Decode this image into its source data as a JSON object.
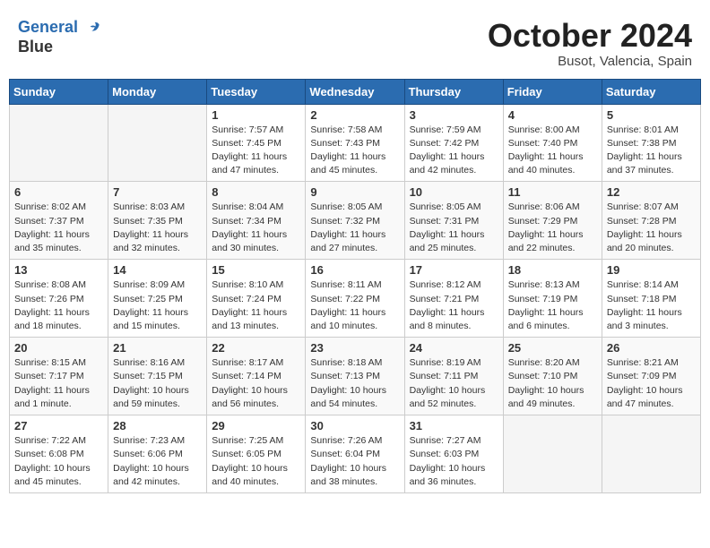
{
  "header": {
    "logo_line1": "General",
    "logo_line2": "Blue",
    "month_title": "October 2024",
    "location": "Busot, Valencia, Spain"
  },
  "weekdays": [
    "Sunday",
    "Monday",
    "Tuesday",
    "Wednesday",
    "Thursday",
    "Friday",
    "Saturday"
  ],
  "weeks": [
    [
      {
        "day": "",
        "sunrise": "",
        "sunset": "",
        "daylight": ""
      },
      {
        "day": "",
        "sunrise": "",
        "sunset": "",
        "daylight": ""
      },
      {
        "day": "1",
        "sunrise": "Sunrise: 7:57 AM",
        "sunset": "Sunset: 7:45 PM",
        "daylight": "Daylight: 11 hours and 47 minutes."
      },
      {
        "day": "2",
        "sunrise": "Sunrise: 7:58 AM",
        "sunset": "Sunset: 7:43 PM",
        "daylight": "Daylight: 11 hours and 45 minutes."
      },
      {
        "day": "3",
        "sunrise": "Sunrise: 7:59 AM",
        "sunset": "Sunset: 7:42 PM",
        "daylight": "Daylight: 11 hours and 42 minutes."
      },
      {
        "day": "4",
        "sunrise": "Sunrise: 8:00 AM",
        "sunset": "Sunset: 7:40 PM",
        "daylight": "Daylight: 11 hours and 40 minutes."
      },
      {
        "day": "5",
        "sunrise": "Sunrise: 8:01 AM",
        "sunset": "Sunset: 7:38 PM",
        "daylight": "Daylight: 11 hours and 37 minutes."
      }
    ],
    [
      {
        "day": "6",
        "sunrise": "Sunrise: 8:02 AM",
        "sunset": "Sunset: 7:37 PM",
        "daylight": "Daylight: 11 hours and 35 minutes."
      },
      {
        "day": "7",
        "sunrise": "Sunrise: 8:03 AM",
        "sunset": "Sunset: 7:35 PM",
        "daylight": "Daylight: 11 hours and 32 minutes."
      },
      {
        "day": "8",
        "sunrise": "Sunrise: 8:04 AM",
        "sunset": "Sunset: 7:34 PM",
        "daylight": "Daylight: 11 hours and 30 minutes."
      },
      {
        "day": "9",
        "sunrise": "Sunrise: 8:05 AM",
        "sunset": "Sunset: 7:32 PM",
        "daylight": "Daylight: 11 hours and 27 minutes."
      },
      {
        "day": "10",
        "sunrise": "Sunrise: 8:05 AM",
        "sunset": "Sunset: 7:31 PM",
        "daylight": "Daylight: 11 hours and 25 minutes."
      },
      {
        "day": "11",
        "sunrise": "Sunrise: 8:06 AM",
        "sunset": "Sunset: 7:29 PM",
        "daylight": "Daylight: 11 hours and 22 minutes."
      },
      {
        "day": "12",
        "sunrise": "Sunrise: 8:07 AM",
        "sunset": "Sunset: 7:28 PM",
        "daylight": "Daylight: 11 hours and 20 minutes."
      }
    ],
    [
      {
        "day": "13",
        "sunrise": "Sunrise: 8:08 AM",
        "sunset": "Sunset: 7:26 PM",
        "daylight": "Daylight: 11 hours and 18 minutes."
      },
      {
        "day": "14",
        "sunrise": "Sunrise: 8:09 AM",
        "sunset": "Sunset: 7:25 PM",
        "daylight": "Daylight: 11 hours and 15 minutes."
      },
      {
        "day": "15",
        "sunrise": "Sunrise: 8:10 AM",
        "sunset": "Sunset: 7:24 PM",
        "daylight": "Daylight: 11 hours and 13 minutes."
      },
      {
        "day": "16",
        "sunrise": "Sunrise: 8:11 AM",
        "sunset": "Sunset: 7:22 PM",
        "daylight": "Daylight: 11 hours and 10 minutes."
      },
      {
        "day": "17",
        "sunrise": "Sunrise: 8:12 AM",
        "sunset": "Sunset: 7:21 PM",
        "daylight": "Daylight: 11 hours and 8 minutes."
      },
      {
        "day": "18",
        "sunrise": "Sunrise: 8:13 AM",
        "sunset": "Sunset: 7:19 PM",
        "daylight": "Daylight: 11 hours and 6 minutes."
      },
      {
        "day": "19",
        "sunrise": "Sunrise: 8:14 AM",
        "sunset": "Sunset: 7:18 PM",
        "daylight": "Daylight: 11 hours and 3 minutes."
      }
    ],
    [
      {
        "day": "20",
        "sunrise": "Sunrise: 8:15 AM",
        "sunset": "Sunset: 7:17 PM",
        "daylight": "Daylight: 11 hours and 1 minute."
      },
      {
        "day": "21",
        "sunrise": "Sunrise: 8:16 AM",
        "sunset": "Sunset: 7:15 PM",
        "daylight": "Daylight: 10 hours and 59 minutes."
      },
      {
        "day": "22",
        "sunrise": "Sunrise: 8:17 AM",
        "sunset": "Sunset: 7:14 PM",
        "daylight": "Daylight: 10 hours and 56 minutes."
      },
      {
        "day": "23",
        "sunrise": "Sunrise: 8:18 AM",
        "sunset": "Sunset: 7:13 PM",
        "daylight": "Daylight: 10 hours and 54 minutes."
      },
      {
        "day": "24",
        "sunrise": "Sunrise: 8:19 AM",
        "sunset": "Sunset: 7:11 PM",
        "daylight": "Daylight: 10 hours and 52 minutes."
      },
      {
        "day": "25",
        "sunrise": "Sunrise: 8:20 AM",
        "sunset": "Sunset: 7:10 PM",
        "daylight": "Daylight: 10 hours and 49 minutes."
      },
      {
        "day": "26",
        "sunrise": "Sunrise: 8:21 AM",
        "sunset": "Sunset: 7:09 PM",
        "daylight": "Daylight: 10 hours and 47 minutes."
      }
    ],
    [
      {
        "day": "27",
        "sunrise": "Sunrise: 7:22 AM",
        "sunset": "Sunset: 6:08 PM",
        "daylight": "Daylight: 10 hours and 45 minutes."
      },
      {
        "day": "28",
        "sunrise": "Sunrise: 7:23 AM",
        "sunset": "Sunset: 6:06 PM",
        "daylight": "Daylight: 10 hours and 42 minutes."
      },
      {
        "day": "29",
        "sunrise": "Sunrise: 7:25 AM",
        "sunset": "Sunset: 6:05 PM",
        "daylight": "Daylight: 10 hours and 40 minutes."
      },
      {
        "day": "30",
        "sunrise": "Sunrise: 7:26 AM",
        "sunset": "Sunset: 6:04 PM",
        "daylight": "Daylight: 10 hours and 38 minutes."
      },
      {
        "day": "31",
        "sunrise": "Sunrise: 7:27 AM",
        "sunset": "Sunset: 6:03 PM",
        "daylight": "Daylight: 10 hours and 36 minutes."
      },
      {
        "day": "",
        "sunrise": "",
        "sunset": "",
        "daylight": ""
      },
      {
        "day": "",
        "sunrise": "",
        "sunset": "",
        "daylight": ""
      }
    ]
  ]
}
